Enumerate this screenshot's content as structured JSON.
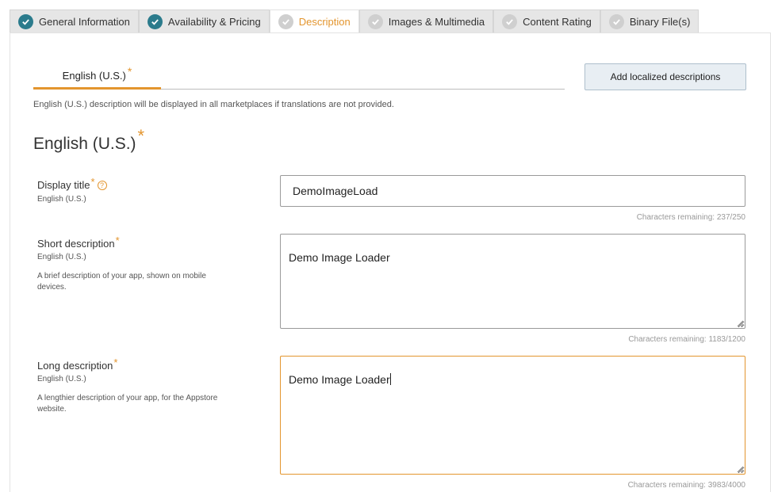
{
  "tabs": [
    {
      "label": "General Information",
      "status": "done"
    },
    {
      "label": "Availability & Pricing",
      "status": "done"
    },
    {
      "label": "Description",
      "status": "active"
    },
    {
      "label": "Images & Multimedia",
      "status": "todo"
    },
    {
      "label": "Content Rating",
      "status": "todo"
    },
    {
      "label": "Binary File(s)",
      "status": "todo"
    }
  ],
  "language_tab": {
    "label": "English (U.S.)",
    "required_mark": "*"
  },
  "add_localized_button": "Add localized descriptions",
  "note": "English (U.S.) description will be displayed in all marketplaces if translations are not provided.",
  "section": {
    "title": "English (U.S.)",
    "required_mark": "*"
  },
  "fields": {
    "display_title": {
      "label": "Display title",
      "required_mark": "*",
      "help": "?",
      "sub": "English (U.S.)",
      "value": "DemoImageLoad",
      "chars_remaining": "Characters remaining: 237/250"
    },
    "short_description": {
      "label": "Short description",
      "required_mark": "*",
      "sub": "English (U.S.)",
      "desc": "A brief description of your app, shown on mobile devices.",
      "value": "Demo Image Loader",
      "chars_remaining": "Characters remaining: 1183/1200"
    },
    "long_description": {
      "label": "Long description",
      "required_mark": "*",
      "sub": "English (U.S.)",
      "desc": "A lengthier description of your app, for the Appstore website.",
      "value": "Demo Image Loader",
      "chars_remaining": "Characters remaining: 3983/4000"
    }
  },
  "colors": {
    "accent": "#e3952e",
    "check_done": "#2b7b8c",
    "check_todo": "#cfcfcf",
    "button_bg": "#e8eef3"
  }
}
